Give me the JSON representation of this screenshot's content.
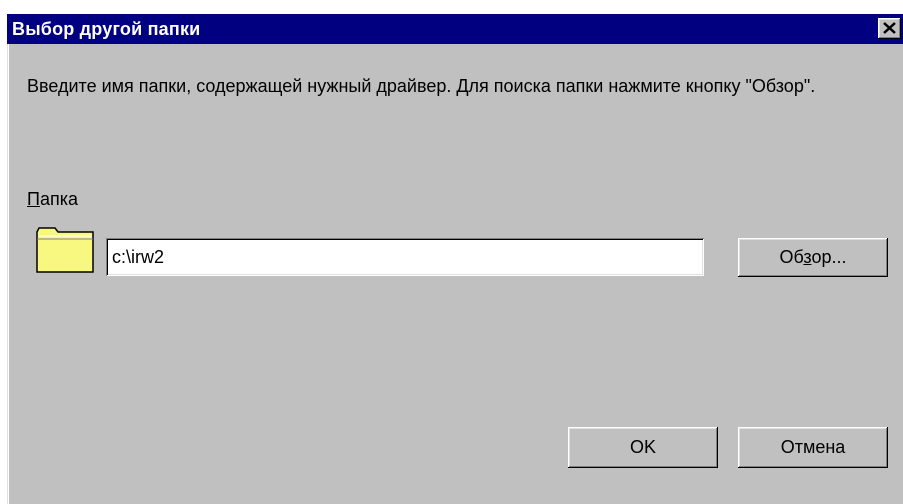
{
  "dialog": {
    "title": "Выбор другой папки",
    "close_label": "×"
  },
  "description": "Введите имя папки, содержащей нужный драйвер. Для поиска папки нажмите кнопку \"Обзор\".",
  "folder": {
    "label_accel": "П",
    "label_rest": "апка",
    "path_value": "c:\\irw2"
  },
  "buttons": {
    "browse_pre": "Об",
    "browse_accel": "з",
    "browse_post": "ор...",
    "ok_label": "OK",
    "cancel_label": "Отмена"
  },
  "colors": {
    "titlebar": "#000080",
    "face": "#c0c0c0",
    "folder": "#f8f880"
  },
  "icons": {
    "folder": "folder-icon",
    "close": "close-icon"
  }
}
